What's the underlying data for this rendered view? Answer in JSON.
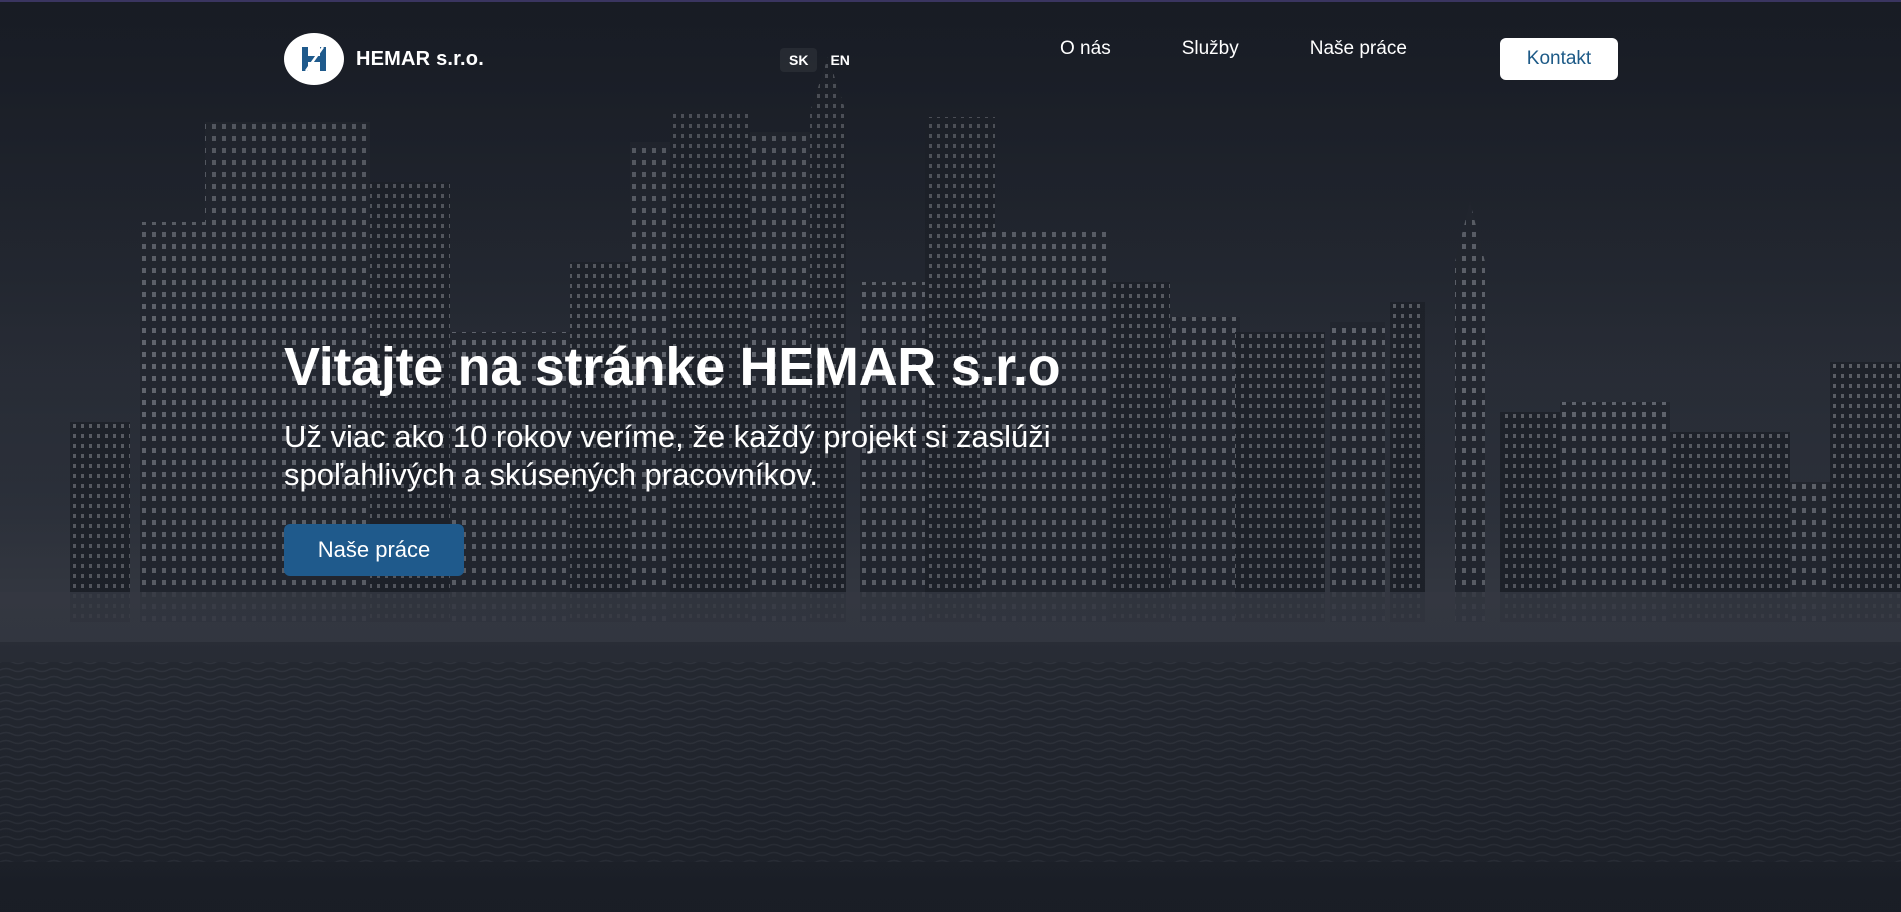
{
  "header": {
    "logo_text": "HEMAR s.r.o.",
    "languages": [
      {
        "code": "SK",
        "active": true
      },
      {
        "code": "EN",
        "active": false
      }
    ],
    "nav": [
      {
        "label": "O nás"
      },
      {
        "label": "Služby"
      },
      {
        "label": "Naše práce"
      }
    ],
    "contact_label": "Kontakt"
  },
  "hero": {
    "title": "Vitajte na stránke HEMAR s.r.o",
    "subtitle": "Už viac ako 10 rokov veríme, že každý projekt si zaslúži spoľahlivých a skúsených pracovníkov.",
    "cta_label": "Naše práce"
  },
  "colors": {
    "accent": "#1f5a8c",
    "contact_text": "#1d5a87",
    "background": "#1a1d24"
  },
  "icons": {
    "logo": "hemar-h-logo-icon"
  }
}
